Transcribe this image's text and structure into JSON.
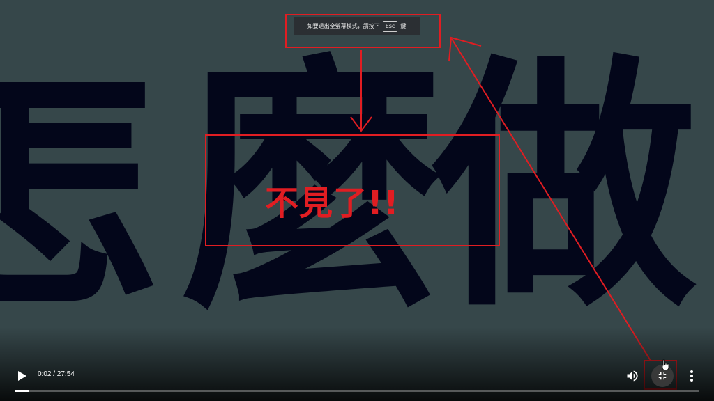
{
  "background": {
    "chars": [
      "怎",
      "麼",
      "做"
    ],
    "color": "#03061a",
    "backdrop": "#36474a"
  },
  "toast": {
    "message": "如要退出全螢幕模式，請按下",
    "key": "Esc",
    "suffix": "鍵"
  },
  "annotation": {
    "text": "不見了!!",
    "color": "#e11d22"
  },
  "player": {
    "time": "0:02 / 27:54",
    "progress": 0.02,
    "icons": {
      "play": "play-icon",
      "volume": "volume-icon",
      "exit_fullscreen": "exit-fullscreen-icon",
      "more": "more-vert-icon"
    }
  }
}
